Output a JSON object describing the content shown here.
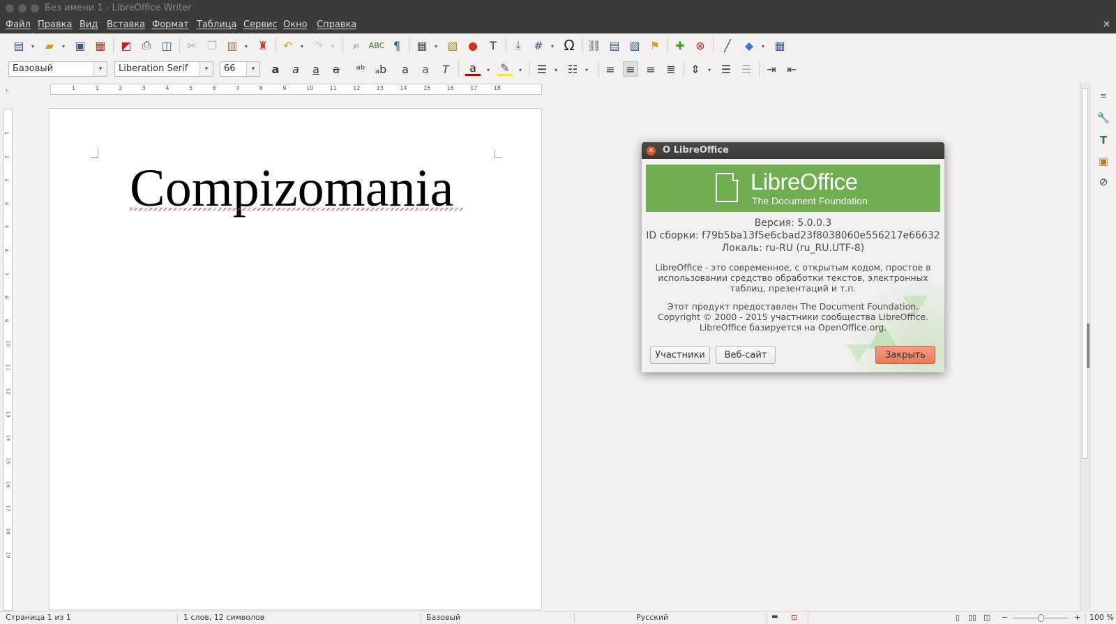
{
  "window": {
    "title": "Без имени 1 - LibreOffice Writer"
  },
  "menubar": {
    "items": [
      "Файл",
      "Правка",
      "Вид",
      "Вставка",
      "Формат",
      "Таблица",
      "Сервис",
      "Окно",
      "Справка"
    ],
    "close_glyph": "✕"
  },
  "formatting": {
    "paragraph_style": "Базовый",
    "font_name": "Liberation Serif",
    "font_size": "66"
  },
  "ruler": {
    "h_numbers": [
      "1",
      "1",
      "2",
      "3",
      "4",
      "5",
      "6",
      "7",
      "8",
      "9",
      "10",
      "11",
      "12",
      "13",
      "14",
      "15",
      "16",
      "17",
      "18"
    ],
    "v_numbers": [
      "1",
      "2",
      "3",
      "4",
      "5",
      "6",
      "7",
      "8",
      "9",
      "10",
      "11",
      "12",
      "13",
      "14",
      "15",
      "16",
      "17",
      "18",
      "19"
    ]
  },
  "document": {
    "text": "Compizomania"
  },
  "statusbar": {
    "page": "Страница 1 из 1",
    "word_count": "1 слов, 12 символов",
    "page_style": "Базовый",
    "language": "Русский",
    "zoom": "100 %"
  },
  "dialog": {
    "title": "О LibreOffice",
    "brand": "LibreOffice",
    "brand_sub": "The Document Foundation",
    "version": "Версия: 5.0.0.3",
    "build_id": "ID сборки: f79b5ba13f5e6cbad23f8038060e556217e66632",
    "locale": "Локаль: ru-RU (ru_RU.UTF-8)",
    "description": [
      "LibreOffice - это современное, с открытым кодом, простое в",
      "использовании средство обработки текстов, электронных",
      "таблиц, презентаций и т.п."
    ],
    "credits": [
      "Этот продукт предоставлен The Document Foundation.",
      "Copyright © 2000 - 2015 участники сообщества LibreOffice.",
      "LibreOffice базируется на OpenOffice.org."
    ],
    "buttons": {
      "credits": "Участники",
      "website": "Веб-сайт",
      "close": "Закрыть"
    }
  },
  "colors": {
    "accent": "#6fad50",
    "close_button": "#ea7b58",
    "titlebar": "#3c3b37"
  }
}
